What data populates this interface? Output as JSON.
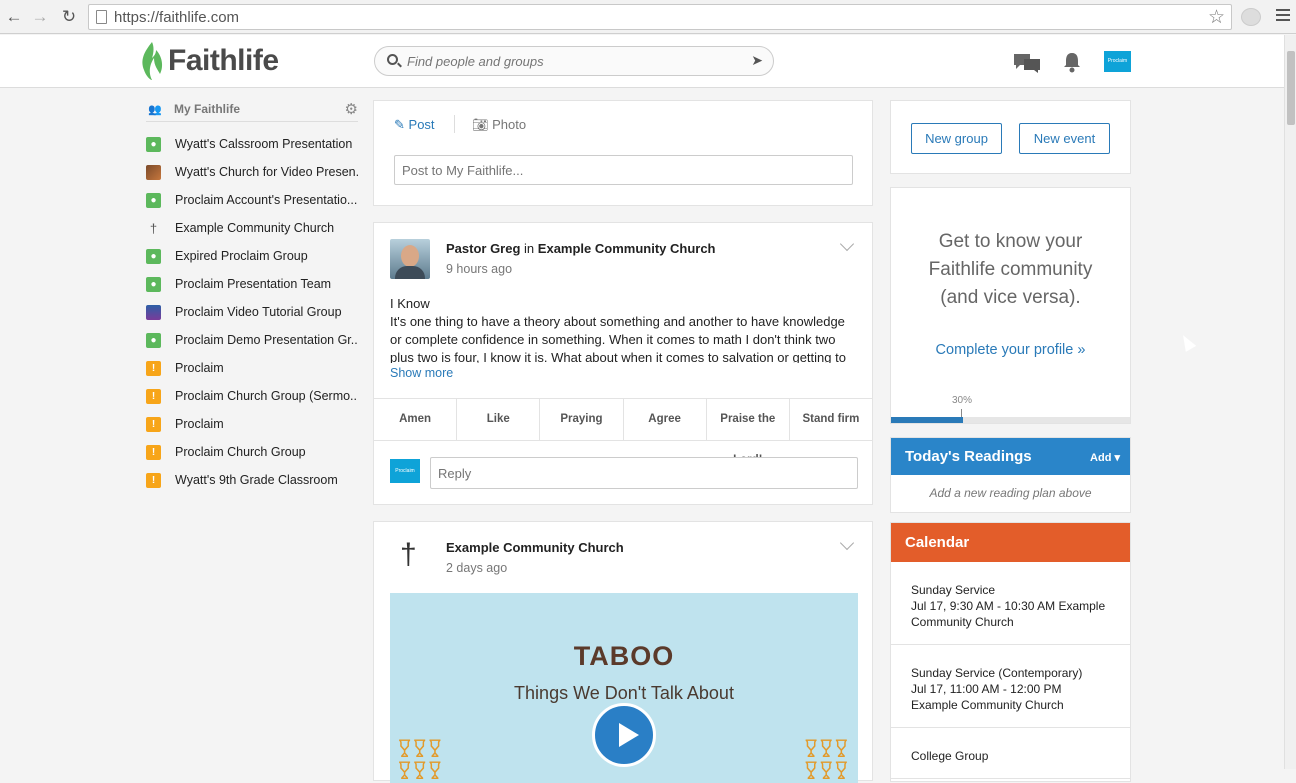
{
  "browser": {
    "url": "https://faithlife.com"
  },
  "header": {
    "logo_text": "Faithlife",
    "search_placeholder": "Find people and groups",
    "badge_text": "Proclaim"
  },
  "sidebar": {
    "title": "My Faithlife",
    "items": [
      {
        "label": "Wyatt's Calssroom Presentation",
        "icon": "group-green"
      },
      {
        "label": "Wyatt's Church for Video Presen...",
        "icon": "photo"
      },
      {
        "label": "Proclaim Account's Presentatio...",
        "icon": "group-green"
      },
      {
        "label": "Example Community Church",
        "icon": "cross"
      },
      {
        "label": "Expired Proclaim Group",
        "icon": "group-green"
      },
      {
        "label": "Proclaim Presentation Team",
        "icon": "group-green"
      },
      {
        "label": "Proclaim Video Tutorial Group",
        "icon": "proclaim-blue"
      },
      {
        "label": "Proclaim Demo Presentation Gr...",
        "icon": "group-green"
      },
      {
        "label": "Proclaim",
        "icon": "warning-orange"
      },
      {
        "label": "Proclaim Church Group (Sermo...",
        "icon": "warning-orange"
      },
      {
        "label": "Proclaim",
        "icon": "warning-orange"
      },
      {
        "label": "Proclaim Church Group",
        "icon": "warning-orange"
      },
      {
        "label": "Wyatt's 9th Grade Classroom",
        "icon": "warning-orange"
      }
    ]
  },
  "composer": {
    "post_tab": "Post",
    "photo_tab": "Photo",
    "placeholder": "Post to My Faithlife..."
  },
  "post1": {
    "author": "Pastor Greg",
    "connector": "in",
    "group": "Example Community Church",
    "time": "9 hours ago",
    "title": "I Know",
    "body": "It's one thing to have a theory about something and another to have knowledge or complete confidence in something. When it comes to math I don't think two plus two is four, I know it is. What about when it comes to salvation or getting to heaven?",
    "show_more": "Show more",
    "reactions": [
      "Amen",
      "Like",
      "Praying",
      "Agree",
      "Praise the Lord!",
      "Stand firm"
    ],
    "reply_placeholder": "Reply",
    "reply_badge": "Proclaim"
  },
  "post2": {
    "author": "Example Community Church",
    "time": "2 days ago",
    "video_title": "TABOO",
    "video_subtitle": "Things We Don't Talk About"
  },
  "right": {
    "new_group": "New group",
    "new_event": "New event",
    "profile_prompt_line1": "Get to know your",
    "profile_prompt_line2": "Faithlife community",
    "profile_prompt_line3": "(and vice versa).",
    "profile_link": "Complete your profile »",
    "profile_progress_label": "30%",
    "profile_progress": 0.3,
    "readings_title": "Today's Readings",
    "readings_add": "Add ▾",
    "readings_note": "Add a new reading plan above",
    "calendar_title": "Calendar",
    "events": [
      {
        "name": "Sunday Service",
        "when": "Jul 17, 9:30 AM - 10:30 AM",
        "where": "Example Community Church"
      },
      {
        "name": "Sunday Service (Contemporary)",
        "when": "Jul 17, 11:00 AM - 12:00 PM",
        "where": "Example Community Church"
      },
      {
        "name": "College Group",
        "when": "",
        "where": ""
      }
    ]
  },
  "colors": {
    "brand_green": "#5cb85c",
    "link_blue": "#2a7ab8",
    "readings_blue": "#2a85c9",
    "calendar_orange": "#e35d2a",
    "proclaim_blue": "#0ea3d8"
  }
}
